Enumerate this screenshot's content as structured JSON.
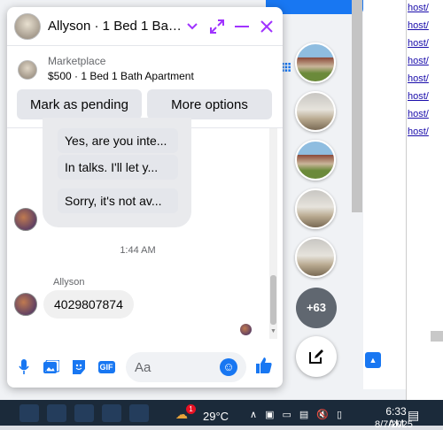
{
  "background": {
    "host_links": [
      "host/",
      "host/",
      "host/",
      "host/",
      "host/",
      "host/",
      "host/",
      "host/"
    ]
  },
  "chat": {
    "title": "Allyson · 1 Bed 1 Bath ...",
    "listing": {
      "label": "Marketplace",
      "info": "$500 · 1 Bed 1 Bath Apartment"
    },
    "actions": {
      "mark_pending": "Mark as pending",
      "more_options": "More options"
    },
    "messages_received": [
      "Yes, are you inte...",
      "In talks. I'll let y...",
      "Sorry, it's not av..."
    ],
    "timestamp": "1:44 AM",
    "sender_name": "Allyson",
    "last_message": "4029807874",
    "composer": {
      "placeholder": "Aa",
      "gif_label": "GIF"
    }
  },
  "chat_heads": {
    "more_count": "+63"
  },
  "taskbar": {
    "notification_count": "1",
    "temperature": "29°C",
    "time": "6:33 AM",
    "date": "8/7/2025"
  },
  "colors": {
    "accent": "#a033ff",
    "messenger_blue": "#1877f2",
    "bubble_gray": "#e4e6eb"
  }
}
